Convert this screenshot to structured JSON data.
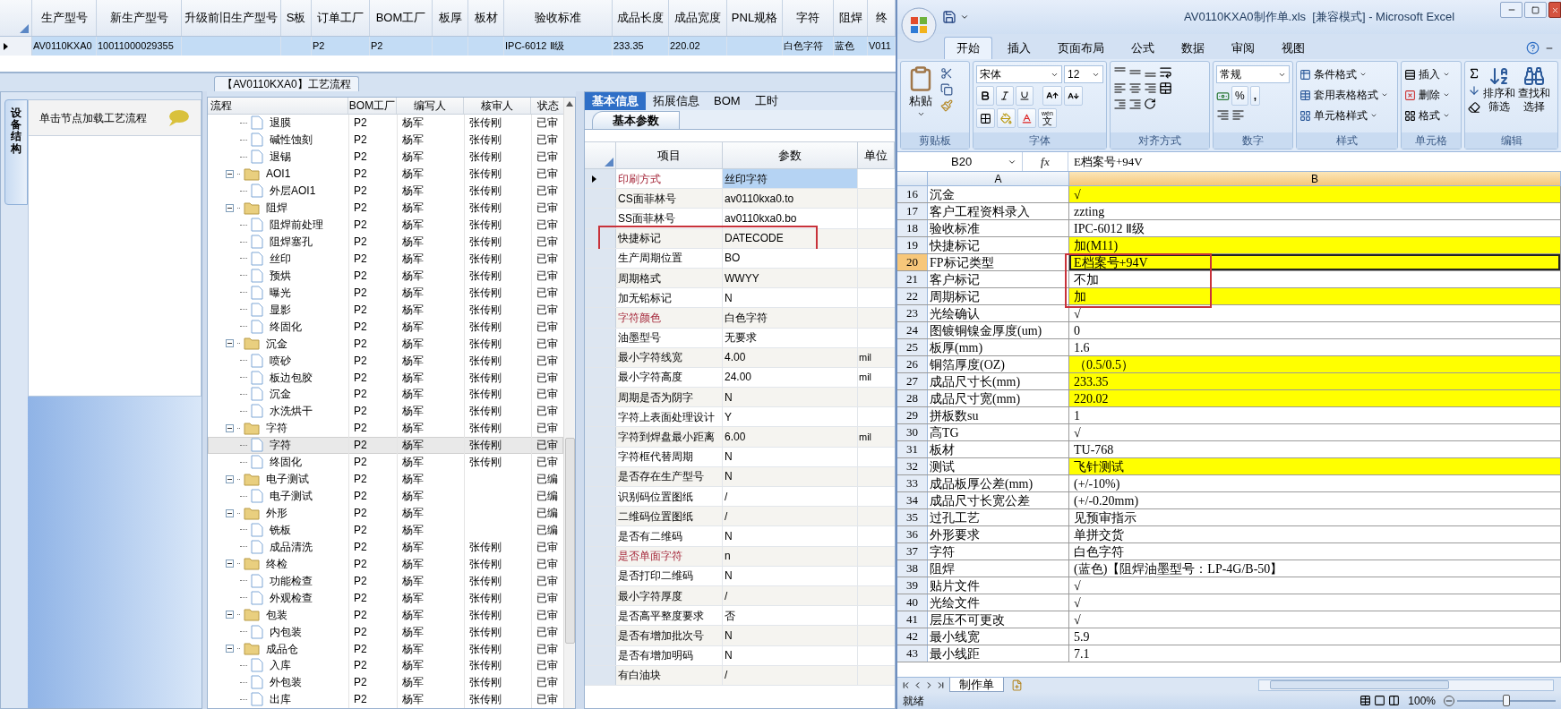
{
  "orders_grid": {
    "columns": [
      "生产型号",
      "新生产型号",
      "升级前旧生产型号",
      "S板",
      "订单工厂",
      "BOM工厂",
      "板厚",
      "板材",
      "验收标准",
      "成品长度",
      "成品宽度",
      "PNL规格",
      "字符",
      "阻焊",
      "终"
    ],
    "rows": [
      {
        "selected": true,
        "cells": [
          "AV0110KXA0",
          "10011000029355",
          null,
          null,
          "P2",
          "P2",
          null,
          null,
          "IPC-6012 Ⅱ级",
          "233.35",
          "220.02",
          null,
          "白色字符",
          "蓝色",
          "V011"
        ]
      }
    ]
  },
  "flow_panel": {
    "title": "【AV0110KXA0】工艺流程",
    "side_tab": "设备结构",
    "hint": "单击节点加载工艺流程",
    "tree": {
      "columns": [
        "流程",
        "BOM工厂",
        "编写人",
        "核审人",
        "状态"
      ],
      "nodes": [
        {
          "kind": "hidden_parent",
          "children": [
            {
              "kind": "step",
              "label": "退膜",
              "bom": "P2",
              "writer": "杨军",
              "reviewer": "张传刚",
              "status": "已审",
              "selected": false
            },
            {
              "kind": "step",
              "label": "碱性蚀刻",
              "bom": "P2",
              "writer": "杨军",
              "reviewer": "张传刚",
              "status": "已审",
              "selected": false
            },
            {
              "kind": "step",
              "label": "退锡",
              "bom": "P2",
              "writer": "杨军",
              "reviewer": "张传刚",
              "status": "已审",
              "selected": false
            }
          ]
        },
        {
          "kind": "folder",
          "label": "AOI1",
          "bom": "P2",
          "writer": "杨军",
          "reviewer": "张传刚",
          "status": "已审",
          "selected": false,
          "expanded": true,
          "children": [
            {
              "kind": "step",
              "label": "外层AOI1",
              "bom": "P2",
              "writer": "杨军",
              "reviewer": "张传刚",
              "status": "已审",
              "selected": false
            }
          ]
        },
        {
          "kind": "folder",
          "label": "阻焊",
          "bom": "P2",
          "writer": "杨军",
          "reviewer": "张传刚",
          "status": "已审",
          "selected": false,
          "expanded": true,
          "children": [
            {
              "kind": "step",
              "label": "阻焊前处理",
              "bom": "P2",
              "writer": "杨军",
              "reviewer": "张传刚",
              "status": "已审",
              "selected": false
            },
            {
              "kind": "step",
              "label": "阻焊塞孔",
              "bom": "P2",
              "writer": "杨军",
              "reviewer": "张传刚",
              "status": "已审",
              "selected": false
            },
            {
              "kind": "step",
              "label": "丝印",
              "bom": "P2",
              "writer": "杨军",
              "reviewer": "张传刚",
              "status": "已审",
              "selected": false
            },
            {
              "kind": "step",
              "label": "预烘",
              "bom": "P2",
              "writer": "杨军",
              "reviewer": "张传刚",
              "status": "已审",
              "selected": false
            },
            {
              "kind": "step",
              "label": "曝光",
              "bom": "P2",
              "writer": "杨军",
              "reviewer": "张传刚",
              "status": "已审",
              "selected": false
            },
            {
              "kind": "step",
              "label": "显影",
              "bom": "P2",
              "writer": "杨军",
              "reviewer": "张传刚",
              "status": "已审",
              "selected": false
            },
            {
              "kind": "step",
              "label": "终固化",
              "bom": "P2",
              "writer": "杨军",
              "reviewer": "张传刚",
              "status": "已审",
              "selected": false
            }
          ]
        },
        {
          "kind": "folder",
          "label": "沉金",
          "bom": "P2",
          "writer": "杨军",
          "reviewer": "张传刚",
          "status": "已审",
          "selected": false,
          "expanded": true,
          "children": [
            {
              "kind": "step",
              "label": "喷砂",
              "bom": "P2",
              "writer": "杨军",
              "reviewer": "张传刚",
              "status": "已审",
              "selected": false
            },
            {
              "kind": "step",
              "label": "板边包胶",
              "bom": "P2",
              "writer": "杨军",
              "reviewer": "张传刚",
              "status": "已审",
              "selected": false
            },
            {
              "kind": "step",
              "label": "沉金",
              "bom": "P2",
              "writer": "杨军",
              "reviewer": "张传刚",
              "status": "已审",
              "selected": false
            },
            {
              "kind": "step",
              "label": "水洗烘干",
              "bom": "P2",
              "writer": "杨军",
              "reviewer": "张传刚",
              "status": "已审",
              "selected": false
            }
          ]
        },
        {
          "kind": "folder",
          "label": "字符",
          "bom": "P2",
          "writer": "杨军",
          "reviewer": "张传刚",
          "status": "已审",
          "selected": false,
          "expanded": true,
          "children": [
            {
              "kind": "step",
              "label": "字符",
              "bom": "P2",
              "writer": "杨军",
              "reviewer": "张传刚",
              "status": "已审",
              "selected": true
            },
            {
              "kind": "step",
              "label": "终固化",
              "bom": "P2",
              "writer": "杨军",
              "reviewer": "张传刚",
              "status": "已审",
              "selected": false
            }
          ]
        },
        {
          "kind": "folder",
          "label": "电子测试",
          "bom": "P2",
          "writer": "杨军",
          "status": "已编",
          "selected": false,
          "expanded": true,
          "children": [
            {
              "kind": "step",
              "label": "电子测试",
              "bom": "P2",
              "writer": "杨军",
              "status": "已编",
              "selected": false
            }
          ]
        },
        {
          "kind": "folder",
          "label": "外形",
          "bom": "P2",
          "writer": "杨军",
          "status": "已编",
          "selected": false,
          "expanded": true,
          "children": [
            {
              "kind": "step",
              "label": "铣板",
              "bom": "P2",
              "writer": "杨军",
              "status": "已编",
              "selected": false
            },
            {
              "kind": "step",
              "label": "成品清洗",
              "bom": "P2",
              "writer": "杨军",
              "reviewer": "张传刚",
              "status": "已审",
              "selected": false
            }
          ]
        },
        {
          "kind": "folder",
          "label": "终检",
          "bom": "P2",
          "writer": "杨军",
          "reviewer": "张传刚",
          "status": "已审",
          "selected": false,
          "expanded": true,
          "children": [
            {
              "kind": "step",
              "label": "功能检查",
              "bom": "P2",
              "writer": "杨军",
              "reviewer": "张传刚",
              "status": "已审",
              "selected": false
            },
            {
              "kind": "step",
              "label": "外观检查",
              "bom": "P2",
              "writer": "杨军",
              "reviewer": "张传刚",
              "status": "已审",
              "selected": false
            }
          ]
        },
        {
          "kind": "folder",
          "label": "包装",
          "bom": "P2",
          "writer": "杨军",
          "reviewer": "张传刚",
          "status": "已审",
          "selected": false,
          "expanded": true,
          "children": [
            {
              "kind": "step",
              "label": "内包装",
              "bom": "P2",
              "writer": "杨军",
              "reviewer": "张传刚",
              "status": "已审",
              "selected": false
            }
          ]
        },
        {
          "kind": "folder",
          "label": "成品仓",
          "bom": "P2",
          "writer": "杨军",
          "reviewer": "张传刚",
          "status": "已审",
          "selected": false,
          "expanded": true,
          "children": [
            {
              "kind": "step",
              "label": "入库",
              "bom": "P2",
              "writer": "杨军",
              "reviewer": "张传刚",
              "status": "已审",
              "selected": false
            },
            {
              "kind": "step",
              "label": "外包装",
              "bom": "P2",
              "writer": "杨军",
              "reviewer": "张传刚",
              "status": "已审",
              "selected": false
            },
            {
              "kind": "step",
              "label": "出库",
              "bom": "P2",
              "writer": "杨军",
              "reviewer": "张传刚",
              "status": "已审",
              "selected": false
            }
          ]
        }
      ]
    }
  },
  "param_panel": {
    "tabs": [
      {
        "label": "基本信息",
        "selected": true
      },
      {
        "label": "拓展信息",
        "selected": false
      },
      {
        "label": "BOM",
        "selected": false
      },
      {
        "label": "工时",
        "selected": false
      }
    ],
    "subtab": "基本参数",
    "columns": [
      "项目",
      "参数",
      "单位"
    ],
    "rows": [
      {
        "item": "印刷方式",
        "value": "丝印字符",
        "emphasized": true,
        "selected": true,
        "boxed": false
      },
      {
        "item": "CS面菲林号",
        "value": "av0110kxa0.to",
        "emphasized": false,
        "selected": false,
        "boxed": false
      },
      {
        "item": "SS面菲林号",
        "value": "av0110kxa0.bo",
        "emphasized": false,
        "selected": false,
        "boxed": false
      },
      {
        "item": "快捷标记",
        "value": "DATECODE",
        "emphasized": false,
        "selected": false,
        "boxed": true
      },
      {
        "item": "生产周期位置",
        "value": "BO",
        "emphasized": false,
        "selected": false,
        "boxed": false
      },
      {
        "item": "周期格式",
        "value": "WWYY",
        "emphasized": false,
        "selected": false,
        "boxed": false
      },
      {
        "item": "加无铅标记",
        "value": "N",
        "emphasized": false,
        "selected": false,
        "boxed": false
      },
      {
        "item": "字符颜色",
        "value": "白色字符",
        "emphasized": true,
        "selected": false,
        "boxed": false
      },
      {
        "item": "油墨型号",
        "value": "无要求",
        "emphasized": false,
        "selected": false,
        "boxed": false
      },
      {
        "item": "最小字符线宽",
        "value": "4.00",
        "unit": "mil",
        "emphasized": false,
        "selected": false,
        "boxed": false
      },
      {
        "item": "最小字符高度",
        "value": "24.00",
        "unit": "mil",
        "emphasized": false,
        "selected": false,
        "boxed": false
      },
      {
        "item": "周期是否为阴字",
        "value": "N",
        "emphasized": false,
        "selected": false,
        "boxed": false
      },
      {
        "item": "字符上表面处理设计",
        "value": "Y",
        "emphasized": false,
        "selected": false,
        "boxed": false
      },
      {
        "item": "字符到焊盘最小距离",
        "value": "6.00",
        "unit": "mil",
        "emphasized": false,
        "selected": false,
        "boxed": false
      },
      {
        "item": "字符框代替周期",
        "value": "N",
        "emphasized": false,
        "selected": false,
        "boxed": false
      },
      {
        "item": "是否存在生产型号",
        "value": "N",
        "emphasized": false,
        "selected": false,
        "boxed": false
      },
      {
        "item": "识别码位置图纸",
        "value": "/",
        "emphasized": false,
        "selected": false,
        "boxed": false
      },
      {
        "item": "二维码位置图纸",
        "value": "/",
        "emphasized": false,
        "selected": false,
        "boxed": false
      },
      {
        "item": "是否有二维码",
        "value": "N",
        "emphasized": false,
        "selected": false,
        "boxed": false
      },
      {
        "item": "是否单面字符",
        "value": "n",
        "emphasized": true,
        "selected": false,
        "boxed": false
      },
      {
        "item": "是否打印二维码",
        "value": "N",
        "emphasized": false,
        "selected": false,
        "boxed": false
      },
      {
        "item": "最小字符厚度",
        "value": "/",
        "emphasized": false,
        "selected": false,
        "boxed": false
      },
      {
        "item": "是否高平整度要求",
        "value": "否",
        "emphasized": false,
        "selected": false,
        "boxed": false
      },
      {
        "item": "是否有增加批次号",
        "value": "N",
        "emphasized": false,
        "selected": false,
        "boxed": false
      },
      {
        "item": "是否有增加明码",
        "value": "N",
        "emphasized": false,
        "selected": false,
        "boxed": false
      },
      {
        "item": "有白油块",
        "value": "/",
        "emphasized": false,
        "selected": false,
        "boxed": false
      }
    ]
  },
  "excel": {
    "title": "AV0110KXA0制作单.xls  [兼容模式] - Microsoft Excel",
    "tabs": [
      {
        "label": "开始",
        "selected": true
      },
      {
        "label": "插入",
        "selected": false
      },
      {
        "label": "页面布局",
        "selected": false
      },
      {
        "label": "公式",
        "selected": false
      },
      {
        "label": "数据",
        "selected": false
      },
      {
        "label": "审阅",
        "selected": false
      },
      {
        "label": "视图",
        "selected": false
      }
    ],
    "ribbon": {
      "clipboard": {
        "label": "剪贴板",
        "paste": "粘贴"
      },
      "font": {
        "label": "字体",
        "name": "宋体",
        "size": "12",
        "ruby": "wén",
        "ruby_glyph": "文"
      },
      "alignment": {
        "label": "对齐方式"
      },
      "number": {
        "label": "数字",
        "format": "常规",
        "percent": "%",
        "comma": ","
      },
      "styles": {
        "label": "样式",
        "items": [
          "条件格式",
          "套用表格格式",
          "单元格样式"
        ]
      },
      "cells": {
        "label": "单元格",
        "items": [
          "插入",
          "删除",
          "格式"
        ]
      },
      "editing": {
        "label": "编辑",
        "sort": [
          "排序和",
          "筛选"
        ],
        "find": [
          "查找和",
          "选择"
        ]
      }
    },
    "name_box": "B20",
    "function_symbol": "fx",
    "formula": "E档案号+94V",
    "columns": [
      "A",
      "B"
    ],
    "rows": [
      {
        "num": "16",
        "a": "沉金",
        "b": "√",
        "highlighted": true,
        "selected": false,
        "boxed": false
      },
      {
        "num": "17",
        "a": "客户工程资料录入",
        "b": "zzting",
        "highlighted": false,
        "selected": false,
        "boxed": false
      },
      {
        "num": "18",
        "a": "验收标准",
        "b": "IPC-6012 Ⅱ级",
        "highlighted": false,
        "selected": false,
        "boxed": false
      },
      {
        "num": "19",
        "a": "快捷标记",
        "b": "加(M11)",
        "highlighted": true,
        "selected": false,
        "boxed": false
      },
      {
        "num": "20",
        "a": "FP标记类型",
        "b": "E档案号+94V",
        "highlighted": true,
        "selected": true,
        "boxed": true
      },
      {
        "num": "21",
        "a": "客户标记",
        "b": "不加",
        "highlighted": false,
        "selected": false,
        "boxed": true
      },
      {
        "num": "22",
        "a": "周期标记",
        "b": "加",
        "highlighted": true,
        "selected": false,
        "boxed": true
      },
      {
        "num": "23",
        "a": "光绘确认",
        "b": "√",
        "highlighted": false,
        "selected": false,
        "boxed": false
      },
      {
        "num": "24",
        "a": "图镀铜镍金厚度(um)",
        "b": "0",
        "highlighted": false,
        "selected": false,
        "boxed": false
      },
      {
        "num": "25",
        "a": "板厚(mm)",
        "b": "1.6",
        "highlighted": false,
        "selected": false,
        "boxed": false
      },
      {
        "num": "26",
        "a": "铜箔厚度(OZ)",
        "b": "（0.5/0.5）",
        "highlighted": true,
        "selected": false,
        "boxed": false
      },
      {
        "num": "27",
        "a": "成品尺寸长(mm)",
        "b": "233.35",
        "highlighted": true,
        "selected": false,
        "boxed": false
      },
      {
        "num": "28",
        "a": "成品尺寸宽(mm)",
        "b": "220.02",
        "highlighted": true,
        "selected": false,
        "boxed": false
      },
      {
        "num": "29",
        "a": "拼板数su",
        "b": "1",
        "highlighted": false,
        "selected": false,
        "boxed": false
      },
      {
        "num": "30",
        "a": "高TG",
        "b": "√",
        "highlighted": false,
        "selected": false,
        "boxed": false
      },
      {
        "num": "31",
        "a": "板材",
        "b": "TU-768",
        "highlighted": false,
        "selected": false,
        "boxed": false
      },
      {
        "num": "32",
        "a": "测试",
        "b": "飞针测试",
        "highlighted": true,
        "selected": false,
        "boxed": false
      },
      {
        "num": "33",
        "a": "成品板厚公差(mm)",
        "b": "(+/-10%)",
        "highlighted": false,
        "selected": false,
        "boxed": false
      },
      {
        "num": "34",
        "a": "成品尺寸长宽公差",
        "b": "(+/-0.20mm)",
        "highlighted": false,
        "selected": false,
        "boxed": false
      },
      {
        "num": "35",
        "a": "过孔工艺",
        "b": "见预审指示",
        "highlighted": false,
        "selected": false,
        "boxed": false
      },
      {
        "num": "36",
        "a": "外形要求",
        "b": "单拼交货",
        "highlighted": false,
        "selected": false,
        "boxed": false
      },
      {
        "num": "37",
        "a": "字符",
        "b": "白色字符",
        "highlighted": false,
        "selected": false,
        "boxed": false
      },
      {
        "num": "38",
        "a": "阻焊",
        "b": "(蓝色)【阻焊油墨型号：LP-4G/B-50】",
        "highlighted": false,
        "selected": false,
        "boxed": false
      },
      {
        "num": "39",
        "a": "贴片文件",
        "b": "√",
        "highlighted": false,
        "selected": false,
        "boxed": false
      },
      {
        "num": "40",
        "a": "光绘文件",
        "b": "√",
        "highlighted": false,
        "selected": false,
        "boxed": false
      },
      {
        "num": "41",
        "a": "层压不可更改",
        "b": "√",
        "highlighted": false,
        "selected": false,
        "boxed": false
      },
      {
        "num": "42",
        "a": "最小线宽",
        "b": "5.9",
        "highlighted": false,
        "selected": false,
        "boxed": false
      },
      {
        "num": "43",
        "a": "最小线距",
        "b": "7.1",
        "highlighted": false,
        "selected": false,
        "boxed": false
      }
    ],
    "sheet_tab": "制作单",
    "status": "就绪",
    "zoom": "100%",
    "zoom_slider": {
      "level": 0.5
    }
  }
}
